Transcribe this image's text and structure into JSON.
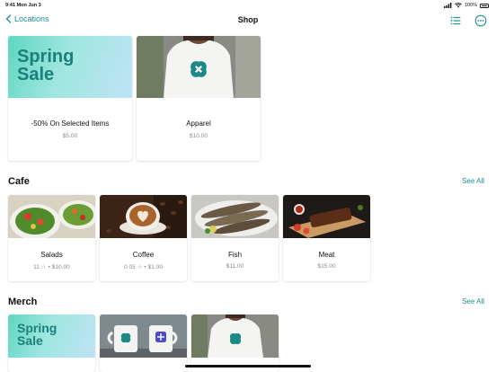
{
  "status": {
    "time": "9:41 Mon Jun 3",
    "battery": "100%"
  },
  "nav": {
    "back_label": "Locations",
    "title": "Shop"
  },
  "featured": [
    {
      "name": "-50% On Selected Items",
      "price": "$5.00",
      "image_text": [
        "Spring",
        "Sale"
      ]
    },
    {
      "name": "Apparel",
      "price": "$10.00"
    }
  ],
  "cafe": {
    "title": "Cafe",
    "see_all": "See All",
    "items": [
      {
        "name": "Salads",
        "sub": "11 ☆ • $10.00"
      },
      {
        "name": "Coffee",
        "sub": "0.05 ☆ • $1.00"
      },
      {
        "name": "Fish",
        "sub": "$11.00"
      },
      {
        "name": "Meat",
        "sub": "$15.00"
      }
    ]
  },
  "merch": {
    "title": "Merch",
    "see_all": "See All",
    "spring_text": [
      "Spring",
      "Sale"
    ]
  },
  "colors": {
    "accent": "#1a8f8f",
    "brand_teal": "#1b7f7c"
  }
}
